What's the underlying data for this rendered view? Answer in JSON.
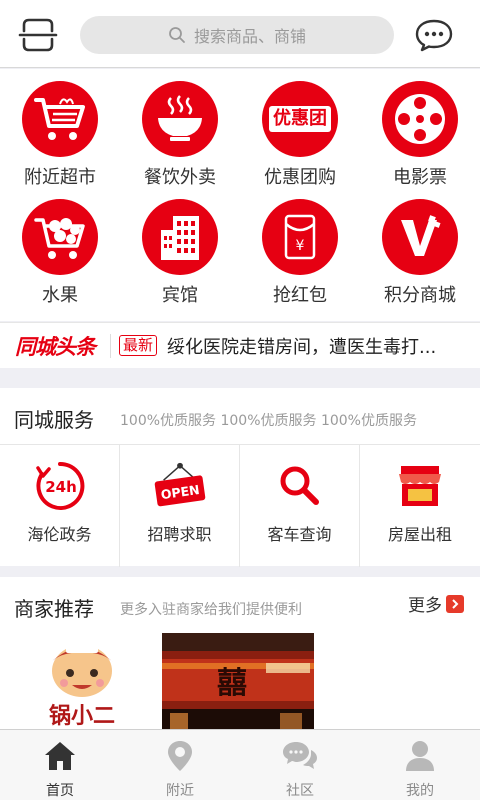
{
  "header": {
    "search_placeholder": "搜索商品、商铺"
  },
  "categories": [
    {
      "label": "附近超市",
      "icon": "shopping-cart-icon"
    },
    {
      "label": "餐饮外卖",
      "icon": "noodle-bowl-icon"
    },
    {
      "label": "优惠团购",
      "icon": "group-buy-logo-icon",
      "logo_text": "优惠团"
    },
    {
      "label": "电影票",
      "icon": "film-reel-icon"
    },
    {
      "label": "水果",
      "icon": "fruit-basket-icon"
    },
    {
      "label": "宾馆",
      "icon": "hotel-building-icon"
    },
    {
      "label": "抢红包",
      "icon": "red-envelope-icon",
      "symbol": "¥"
    },
    {
      "label": "积分商城",
      "icon": "points-mall-v-icon"
    }
  ],
  "headline": {
    "logo": "同城头条",
    "badge": "最新",
    "text": "绥化医院走错房间，遭医生毒打..."
  },
  "services": {
    "title": "同城服务",
    "subtitle": "100%优质服务 100%优质服务 100%优质服务",
    "items": [
      {
        "label": "海伦政务",
        "icon": "24h-clock-icon",
        "icon_text": "24h"
      },
      {
        "label": "招聘求职",
        "icon": "open-sign-icon",
        "icon_text": "OPEN"
      },
      {
        "label": "客车查询",
        "icon": "search-magnifier-icon"
      },
      {
        "label": "房屋出租",
        "icon": "storefront-icon"
      }
    ]
  },
  "merchants": {
    "title": "商家推荐",
    "subtitle": "更多入驻商家给我们提供便利",
    "more": "更多",
    "cards": [
      {
        "name": "锅小二",
        "icon": "chef-mascot-logo"
      },
      {
        "name": "restaurant-photo",
        "icon": "restaurant-storefront-photo"
      }
    ]
  },
  "tabbar": [
    {
      "label": "首页",
      "icon": "home-icon",
      "active": true
    },
    {
      "label": "附近",
      "icon": "location-pin-icon",
      "active": false
    },
    {
      "label": "社区",
      "icon": "chat-bubbles-icon",
      "active": false
    },
    {
      "label": "我的",
      "icon": "person-icon",
      "active": false
    }
  ],
  "colors": {
    "brand_red": "#e60012",
    "background": "#efeff4"
  }
}
